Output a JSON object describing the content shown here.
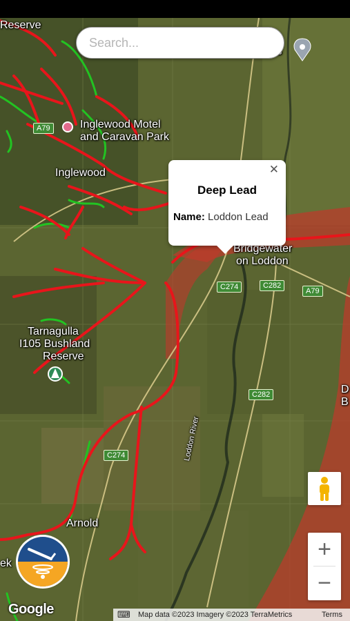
{
  "search": {
    "placeholder": "Search..."
  },
  "popup": {
    "title": "Deep Lead",
    "name_label": "Name:",
    "name_value": "Loddon Lead",
    "close_glyph": "✕"
  },
  "map_labels": {
    "reserve": "Reserve",
    "inglewood_motel_1": "Inglewood Motel",
    "inglewood_motel_2": "and Caravan Park",
    "inglewood": "Inglewood",
    "bridgewater_1": "Bridgewater",
    "bridgewater_2": "on Loddon",
    "tarnagulla_1": "Tarnagulla",
    "tarnagulla_2": "I105 Bushland",
    "tarnagulla_3": "Reserve",
    "arnold": "Arnold",
    "loddon_river": "Loddon River",
    "ek": "ek",
    "ts": "ts",
    "d": "D",
    "b": "B"
  },
  "roads": {
    "a79_left": "A79",
    "a79_right": "A79",
    "c274_top": "C274",
    "c282_top": "C282",
    "c282_mid": "C282",
    "c274_bottom": "C274"
  },
  "controls": {
    "zoom_in": "+",
    "zoom_out": "−"
  },
  "attribution": {
    "keyboard_icon": "⌨",
    "map_data": "Map data ©2023 Imagery ©2023 TerraMetrics",
    "terms": "Terms"
  },
  "google_logo": "Google",
  "colors": {
    "overlay_red": "#e8151b",
    "overlay_green": "#22c322",
    "zone_fill": "#c0392b"
  }
}
